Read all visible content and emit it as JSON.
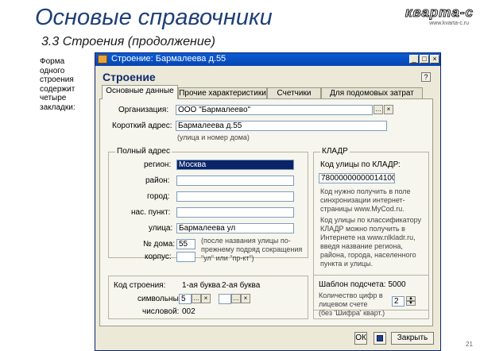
{
  "slide": {
    "title": "Основые справочники",
    "subtitle": "3.3  Строения (продолжение)",
    "logo_brand": "кварта-с",
    "logo_site": "www.kvarta-c.ru",
    "side_note": "Форма одного строения содержит четыре закладки:",
    "slide_number": "21"
  },
  "window": {
    "title": "Строение: Бармалеева д.55",
    "heading": "Строение",
    "help": "?",
    "controls": [
      "_",
      "□",
      "×"
    ]
  },
  "tabs": [
    "Основные данные",
    "Прочие характеристики",
    "Счетчики",
    "Для подомовых затрат"
  ],
  "main": {
    "org_label": "Организация:",
    "org_value": "ООО \"Бармалеево\"",
    "short_label": "Короткий адрес:",
    "short_value": "Бармалеева д.55",
    "short_hint": "(улица и номер дома)"
  },
  "address": {
    "legend": "Полный адрес",
    "fields": [
      {
        "label": "регион:",
        "value": "Москва"
      },
      {
        "label": "район:",
        "value": ""
      },
      {
        "label": "город:",
        "value": ""
      },
      {
        "label": "нас. пункт:",
        "value": ""
      },
      {
        "label": "улица:",
        "value": "Бармалеева ул"
      }
    ],
    "house_label": "№ дома:",
    "house_value": "55",
    "korpus_label": "корпус:",
    "korpus_value": "",
    "house_hint": "(после названия улицы по-прежнему подряд сокращения \"ул\" или \"пр-кт\")"
  },
  "kladr": {
    "legend": "КЛАДР",
    "code_label": "Код улицы по КЛАДР:",
    "code_value": "780000000000141000",
    "note1": "Код нужно получить в поле синхронизации интернет-страницы www.MyCod.ru.",
    "note2": "Код улицы по классификатору КЛАДР можно получить в Интернете на www.nlkladr.ru, введя название региона, района, города, населенного пункта и улицы."
  },
  "code_section": {
    "label": "Код строения:",
    "col1": "1-ая буква",
    "col2": "2-ая буква",
    "sym_label": "символьный:",
    "sym1": "5",
    "sym2": "",
    "num_label": "числовой:",
    "num_value": "002"
  },
  "counters": {
    "template_label": "Шаблон подсчета: 5000",
    "qty_label": "Количество цифр в лицевом счете",
    "qty_note": "(без 'Шифра' кварт.)",
    "qty_value": "2"
  },
  "buttons": {
    "ok": "ОК",
    "save_icon": "save-icon",
    "close": "Закрыть"
  }
}
